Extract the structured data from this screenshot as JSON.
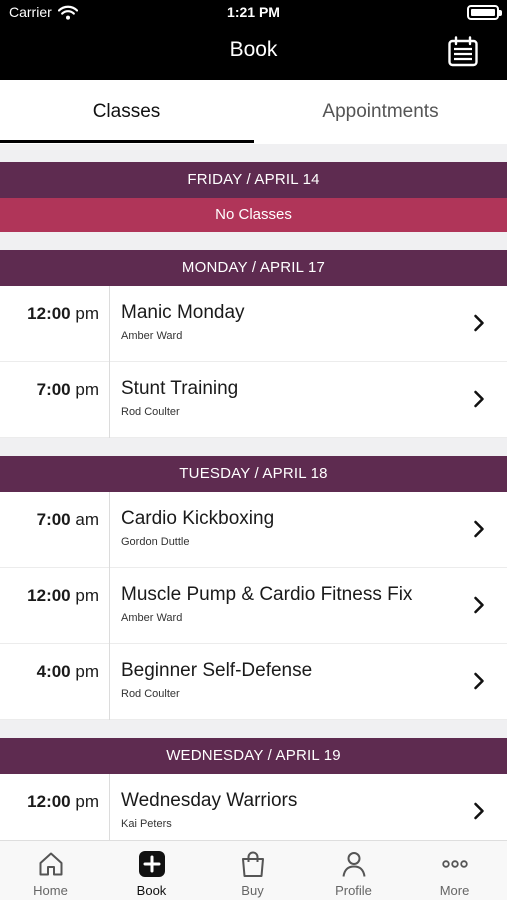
{
  "status_bar": {
    "carrier": "Carrier",
    "time": "1:21 PM"
  },
  "header": {
    "title": "Book",
    "calendar_icon": "calendar-icon"
  },
  "tabs": [
    {
      "label": "Classes",
      "active": true
    },
    {
      "label": "Appointments",
      "active": false
    }
  ],
  "schedule": [
    {
      "day": "FRIDAY / APRIL 14",
      "empty_label": "No Classes",
      "classes": []
    },
    {
      "day": "MONDAY / APRIL 17",
      "classes": [
        {
          "time_num": "12:00",
          "time_suffix": "pm",
          "name": "Manic Monday",
          "instructor": "Amber Ward"
        },
        {
          "time_num": "7:00",
          "time_suffix": "pm",
          "name": "Stunt Training",
          "instructor": "Rod Coulter"
        }
      ]
    },
    {
      "day": "TUESDAY / APRIL 18",
      "classes": [
        {
          "time_num": "7:00",
          "time_suffix": "am",
          "name": "Cardio Kickboxing",
          "instructor": "Gordon Duttle"
        },
        {
          "time_num": "12:00",
          "time_suffix": "pm",
          "name": "Muscle Pump & Cardio Fitness Fix",
          "instructor": "Amber Ward"
        },
        {
          "time_num": "4:00",
          "time_suffix": "pm",
          "name": "Beginner Self-Defense",
          "instructor": "Rod Coulter"
        }
      ]
    },
    {
      "day": "WEDNESDAY / APRIL 19",
      "classes": [
        {
          "time_num": "12:00",
          "time_suffix": "pm",
          "name": "Wednesday Warriors",
          "instructor": "Kai Peters"
        }
      ]
    }
  ],
  "tab_bar": [
    {
      "label": "Home",
      "icon": "home-icon",
      "active": false
    },
    {
      "label": "Book",
      "icon": "plus-square-icon",
      "active": true
    },
    {
      "label": "Buy",
      "icon": "shopping-bag-icon",
      "active": false
    },
    {
      "label": "Profile",
      "icon": "person-icon",
      "active": false
    },
    {
      "label": "More",
      "icon": "ellipsis-icon",
      "active": false
    }
  ],
  "colors": {
    "day_header": "#5e2b50",
    "no_classes": "#b03559",
    "header_bg": "#000000"
  }
}
